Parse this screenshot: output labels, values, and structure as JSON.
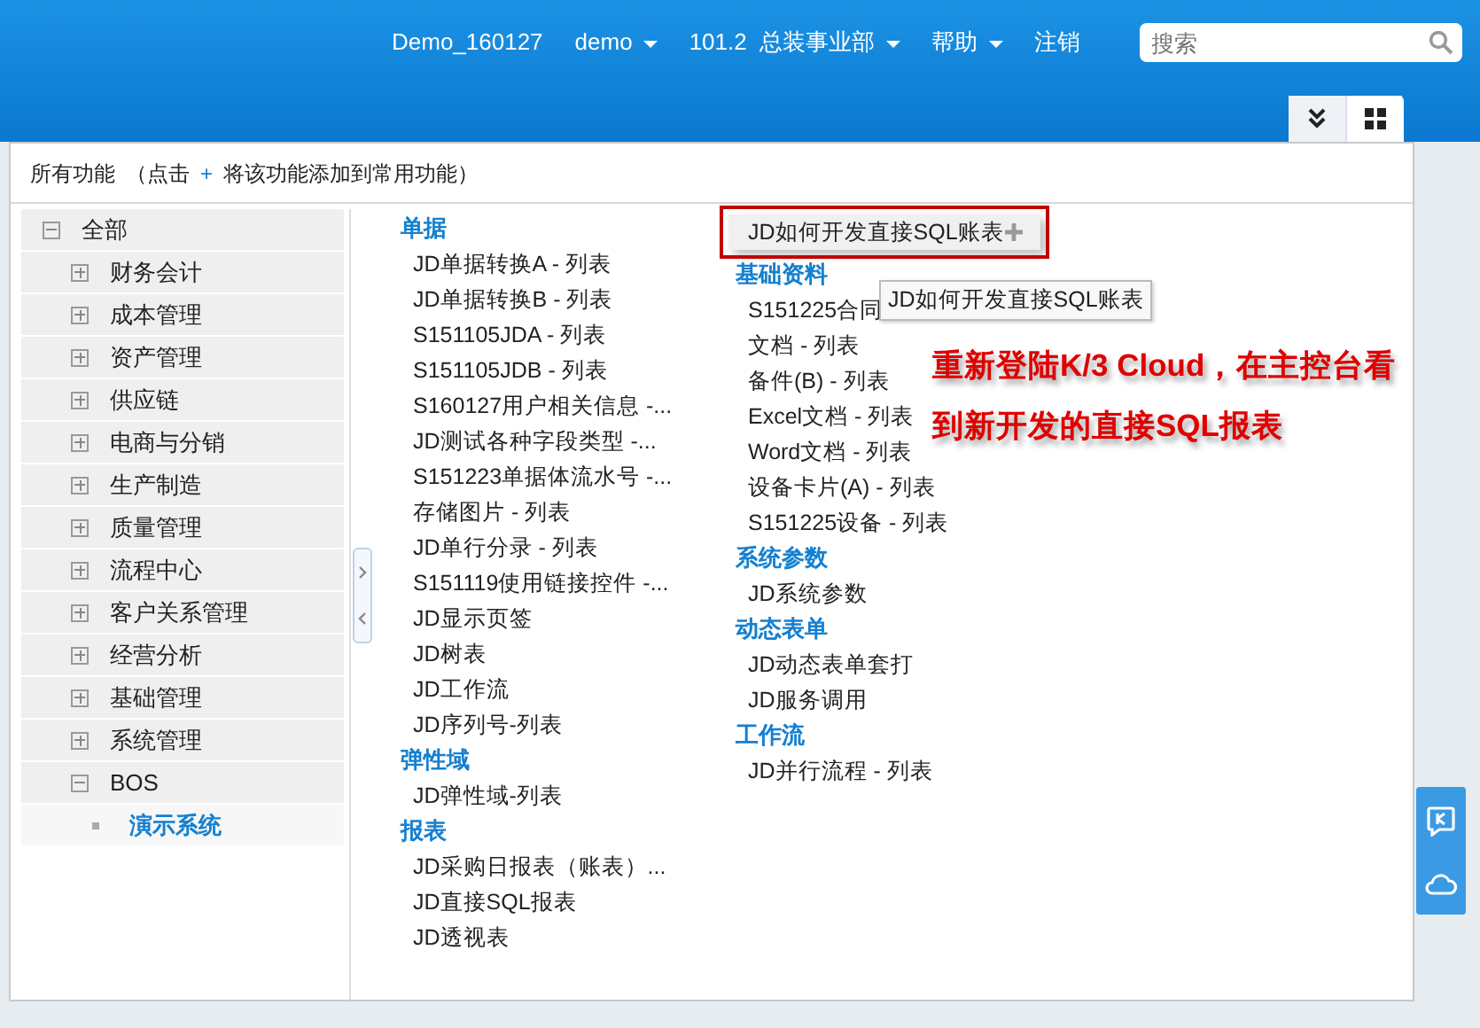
{
  "navbar": {
    "items": [
      {
        "label": "Demo_160127",
        "dropdown": false
      },
      {
        "label": "demo",
        "dropdown": true
      },
      {
        "label": "101.2  总装事业部",
        "dropdown": true
      },
      {
        "label": "帮助",
        "dropdown": true
      },
      {
        "label": "注销",
        "dropdown": false
      }
    ],
    "search": {
      "placeholder": "搜索"
    }
  },
  "panel": {
    "title": "所有功能",
    "hint_open": "（点击",
    "hint_plus": "+",
    "hint_rest": "将该功能添加到常用功能）",
    "tree": {
      "label": "全部",
      "expanded": true,
      "selected": false,
      "children": [
        {
          "label": "财务会计",
          "expanded": false,
          "selected": false
        },
        {
          "label": "成本管理",
          "expanded": false,
          "selected": false
        },
        {
          "label": "资产管理",
          "expanded": false,
          "selected": false
        },
        {
          "label": "供应链",
          "expanded": false,
          "selected": false
        },
        {
          "label": "电商与分销",
          "expanded": false,
          "selected": false
        },
        {
          "label": "生产制造",
          "expanded": false,
          "selected": false
        },
        {
          "label": "质量管理",
          "expanded": false,
          "selected": false
        },
        {
          "label": "流程中心",
          "expanded": false,
          "selected": false
        },
        {
          "label": "客户关系管理",
          "expanded": false,
          "selected": false
        },
        {
          "label": "经营分析",
          "expanded": false,
          "selected": false
        },
        {
          "label": "基础管理",
          "expanded": false,
          "selected": false
        },
        {
          "label": "系统管理",
          "expanded": false,
          "selected": false
        },
        {
          "label": "BOS",
          "expanded": true,
          "selected": false,
          "children": [
            {
              "label": "演示系统",
              "selected": true
            }
          ]
        }
      ]
    },
    "columns": [
      {
        "groups": [
          {
            "title": "单据",
            "items": [
              {
                "label": "JD单据转换A - 列表",
                "hovered": false
              },
              {
                "label": "JD单据转换B - 列表",
                "hovered": false
              },
              {
                "label": "S151105JDA - 列表",
                "hovered": false
              },
              {
                "label": "S151105JDB - 列表",
                "hovered": false
              },
              {
                "label": "S160127用户相关信息  -...",
                "hovered": false
              },
              {
                "label": "JD测试各种字段类型  -...",
                "hovered": false
              },
              {
                "label": "S151223单据体流水号  -...",
                "hovered": false
              },
              {
                "label": "存储图片  - 列表",
                "hovered": false
              },
              {
                "label": "JD单行分录  - 列表",
                "hovered": false
              },
              {
                "label": "S151119使用链接控件  -...",
                "hovered": false
              },
              {
                "label": "JD显示页签",
                "hovered": false
              },
              {
                "label": "JD树表",
                "hovered": false
              },
              {
                "label": "JD工作流",
                "hovered": false
              },
              {
                "label": "JD序列号-列表",
                "hovered": false
              }
            ]
          },
          {
            "title": "弹性域",
            "items": [
              {
                "label": "JD弹性域-列表",
                "hovered": false
              }
            ]
          },
          {
            "title": "报表",
            "items": [
              {
                "label": "JD采购日报表（账表）...",
                "hovered": false
              },
              {
                "label": "JD直接SQL报表",
                "hovered": false
              },
              {
                "label": "JD透视表",
                "hovered": false
              }
            ]
          }
        ]
      },
      {
        "groups": [
          {
            "items": [
              {
                "label": "JD如何开发直接SQL账表",
                "hovered": true,
                "framed": true
              }
            ]
          },
          {
            "title": "基础资料",
            "items": [
              {
                "label": "S151225合同",
                "hovered": false
              },
              {
                "label": "文档  - 列表",
                "hovered": false
              },
              {
                "label": "备件(B) - 列表",
                "hovered": false
              },
              {
                "label": "Excel文档  - 列表",
                "hovered": false
              },
              {
                "label": "Word文档  - 列表",
                "hovered": false
              },
              {
                "label": "设备卡片(A) - 列表",
                "hovered": false
              },
              {
                "label": "S151225设备  - 列表",
                "hovered": false
              }
            ]
          },
          {
            "title": "系统参数",
            "items": [
              {
                "label": "JD系统参数",
                "hovered": false
              }
            ]
          },
          {
            "title": "动态表单",
            "items": [
              {
                "label": "JD动态表单套打",
                "hovered": false
              },
              {
                "label": "JD服务调用",
                "hovered": false
              }
            ]
          },
          {
            "title": "工作流",
            "items": [
              {
                "label": "JD并行流程  - 列表",
                "hovered": false
              }
            ]
          }
        ]
      }
    ],
    "tooltip": "JD如何开发直接SQL账表"
  },
  "annotation": {
    "lines": [
      "重新登陆K/3 Cloud，在主控台看",
      "到新开发的直接SQL报表"
    ]
  }
}
